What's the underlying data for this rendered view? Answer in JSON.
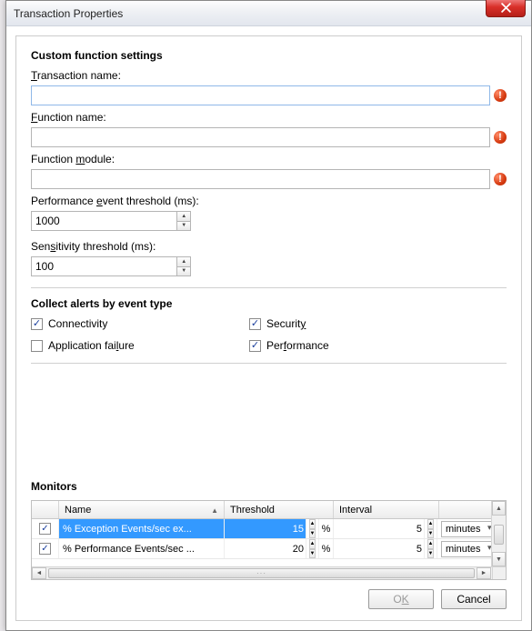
{
  "window": {
    "title": "Transaction Properties"
  },
  "custom": {
    "heading": "Custom function settings",
    "transaction_label_pre": "T",
    "transaction_label_post": "ransaction name:",
    "function_label_pre": "F",
    "function_label_post": "unction name:",
    "module_label_pre": "Function ",
    "module_label_u": "m",
    "module_label_post": "odule:",
    "perf_label_pre": "Performance ",
    "perf_label_u": "e",
    "perf_label_post": "vent threshold (ms):",
    "perf_value": "1000",
    "sens_label_pre": "Sen",
    "sens_label_u": "s",
    "sens_label_post": "itivity threshold (ms):",
    "sens_value": "100",
    "transaction_value": "",
    "function_value": "",
    "module_value": ""
  },
  "alerts": {
    "heading": "Collect alerts by event type",
    "connectivity": {
      "label": "Connectivity",
      "checked": true
    },
    "security": {
      "label_pre": "Securit",
      "label_u": "y",
      "checked": true
    },
    "failure": {
      "label_pre": "Application fai",
      "label_u": "l",
      "label_post": "ure",
      "checked": false
    },
    "performance": {
      "label_pre": "Per",
      "label_u": "f",
      "label_post": "ormance",
      "checked": true
    }
  },
  "monitors": {
    "heading": "Monitors",
    "columns": {
      "name": "Name",
      "threshold": "Threshold",
      "interval": "Interval"
    },
    "pct": "%",
    "rows": [
      {
        "checked": true,
        "name": "% Exception Events/sec ex...",
        "threshold": "15",
        "interval": "5",
        "unit": "minutes",
        "selected": true
      },
      {
        "checked": true,
        "name": "% Performance Events/sec ...",
        "threshold": "20",
        "interval": "5",
        "unit": "minutes",
        "selected": false
      }
    ]
  },
  "buttons": {
    "ok_pre": "O",
    "ok_u": "K",
    "cancel": "Cancel"
  },
  "error_icon": "!"
}
